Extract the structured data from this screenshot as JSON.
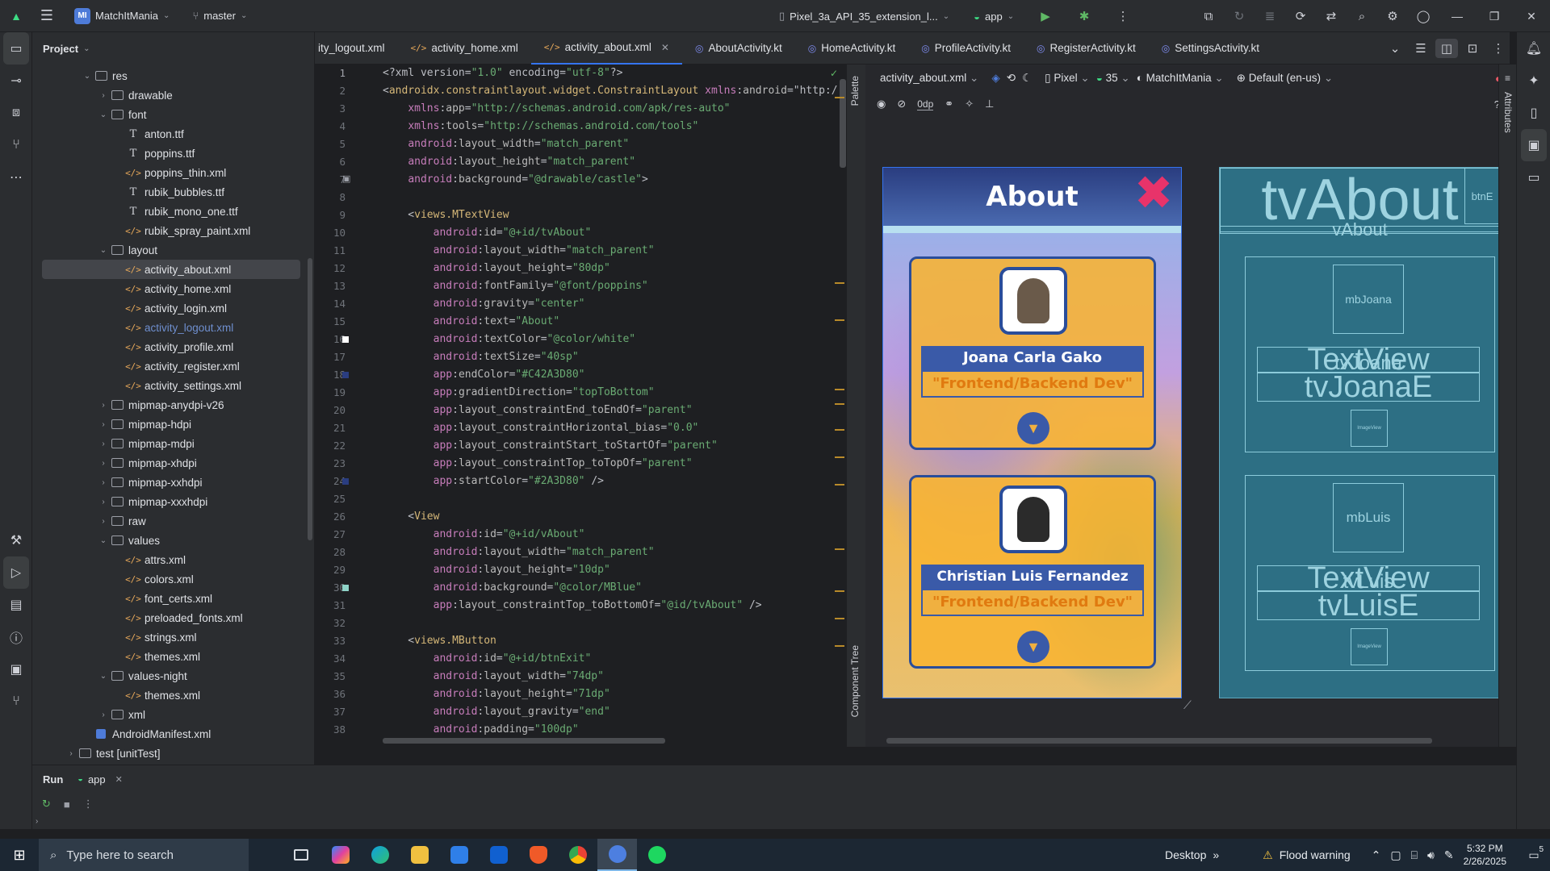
{
  "titlebar": {
    "project_initials": "MI",
    "project_name": "MatchItMania",
    "branch": "master",
    "device": "Pixel_3a_API_35_extension_l...",
    "run_config": "app"
  },
  "project_panel": {
    "title": "Project",
    "tree": [
      {
        "label": "res",
        "type": "folder",
        "depth": 3,
        "open": true
      },
      {
        "label": "drawable",
        "type": "folder",
        "depth": 4,
        "open": false
      },
      {
        "label": "font",
        "type": "folder",
        "depth": 4,
        "open": true
      },
      {
        "label": "anton.ttf",
        "type": "ttf",
        "depth": 5
      },
      {
        "label": "poppins.ttf",
        "type": "ttf",
        "depth": 5
      },
      {
        "label": "poppins_thin.xml",
        "type": "xml",
        "depth": 5
      },
      {
        "label": "rubik_bubbles.ttf",
        "type": "ttf",
        "depth": 5
      },
      {
        "label": "rubik_mono_one.ttf",
        "type": "ttf",
        "depth": 5
      },
      {
        "label": "rubik_spray_paint.xml",
        "type": "xml",
        "depth": 5
      },
      {
        "label": "layout",
        "type": "folder",
        "depth": 4,
        "open": true
      },
      {
        "label": "activity_about.xml",
        "type": "xml",
        "depth": 5,
        "selected": true
      },
      {
        "label": "activity_home.xml",
        "type": "xml",
        "depth": 5
      },
      {
        "label": "activity_login.xml",
        "type": "xml",
        "depth": 5
      },
      {
        "label": "activity_logout.xml",
        "type": "xml",
        "depth": 5,
        "dim": true
      },
      {
        "label": "activity_profile.xml",
        "type": "xml",
        "depth": 5
      },
      {
        "label": "activity_register.xml",
        "type": "xml",
        "depth": 5
      },
      {
        "label": "activity_settings.xml",
        "type": "xml",
        "depth": 5
      },
      {
        "label": "mipmap-anydpi-v26",
        "type": "folder",
        "depth": 4,
        "open": false
      },
      {
        "label": "mipmap-hdpi",
        "type": "folder",
        "depth": 4,
        "open": false
      },
      {
        "label": "mipmap-mdpi",
        "type": "folder",
        "depth": 4,
        "open": false
      },
      {
        "label": "mipmap-xhdpi",
        "type": "folder",
        "depth": 4,
        "open": false
      },
      {
        "label": "mipmap-xxhdpi",
        "type": "folder",
        "depth": 4,
        "open": false
      },
      {
        "label": "mipmap-xxxhdpi",
        "type": "folder",
        "depth": 4,
        "open": false
      },
      {
        "label": "raw",
        "type": "folder",
        "depth": 4,
        "open": false
      },
      {
        "label": "values",
        "type": "folder",
        "depth": 4,
        "open": true
      },
      {
        "label": "attrs.xml",
        "type": "xml",
        "depth": 5
      },
      {
        "label": "colors.xml",
        "type": "xml",
        "depth": 5
      },
      {
        "label": "font_certs.xml",
        "type": "xml",
        "depth": 5
      },
      {
        "label": "preloaded_fonts.xml",
        "type": "xml",
        "depth": 5
      },
      {
        "label": "strings.xml",
        "type": "xml",
        "depth": 5
      },
      {
        "label": "themes.xml",
        "type": "xml",
        "depth": 5
      },
      {
        "label": "values-night",
        "type": "folder",
        "depth": 4,
        "open": true
      },
      {
        "label": "themes.xml",
        "type": "xml",
        "depth": 5
      },
      {
        "label": "xml",
        "type": "folder",
        "depth": 4,
        "open": false
      },
      {
        "label": "AndroidManifest.xml",
        "type": "manifest",
        "depth": 3
      },
      {
        "label": "test [unitTest]",
        "type": "folder",
        "depth": 2,
        "open": false
      }
    ]
  },
  "tabs": [
    {
      "label": "ity_logout.xml",
      "kind": "xml"
    },
    {
      "label": "activity_home.xml",
      "kind": "xml"
    },
    {
      "label": "activity_about.xml",
      "kind": "xml",
      "active": true
    },
    {
      "label": "AboutActivity.kt",
      "kind": "kt"
    },
    {
      "label": "HomeActivity.kt",
      "kind": "kt"
    },
    {
      "label": "ProfileActivity.kt",
      "kind": "kt"
    },
    {
      "label": "RegisterActivity.kt",
      "kind": "kt"
    },
    {
      "label": "SettingsActivity.kt",
      "kind": "kt"
    }
  ],
  "code_lines": [
    "<?xml version=\"1.0\" encoding=\"utf-8\"?>",
    "<androidx.constraintlayout.widget.ConstraintLayout xmlns:android=\"http:/",
    "    xmlns:app=\"http://schemas.android.com/apk/res-auto\"",
    "    xmlns:tools=\"http://schemas.android.com/tools\"",
    "    android:layout_width=\"match_parent\"",
    "    android:layout_height=\"match_parent\"",
    "    android:background=\"@drawable/castle\">",
    "",
    "    <views.MTextView",
    "        android:id=\"@+id/tvAbout\"",
    "        android:layout_width=\"match_parent\"",
    "        android:layout_height=\"80dp\"",
    "        android:fontFamily=\"@font/poppins\"",
    "        android:gravity=\"center\"",
    "        android:text=\"About\"",
    "        android:textColor=\"@color/white\"",
    "        android:textSize=\"40sp\"",
    "        app:endColor=\"#C42A3D80\"",
    "        app:gradientDirection=\"topToBottom\"",
    "        app:layout_constraintEnd_toEndOf=\"parent\"",
    "        app:layout_constraintHorizontal_bias=\"0.0\"",
    "        app:layout_constraintStart_toStartOf=\"parent\"",
    "        app:layout_constraintTop_toTopOf=\"parent\"",
    "        app:startColor=\"#2A3D80\" />",
    "",
    "    <View",
    "        android:id=\"@+id/vAbout\"",
    "        android:layout_width=\"match_parent\"",
    "        android:layout_height=\"10dp\"",
    "        android:background=\"@color/MBlue\"",
    "        app:layout_constraintTop_toBottomOf=\"@id/tvAbout\" />",
    "",
    "    <views.MButton",
    "        android:id=\"@+id/btnExit\"",
    "        android:layout_width=\"74dp\"",
    "        android:layout_height=\"71dp\"",
    "        android:layout_gravity=\"end\"",
    "        android:padding=\"100dp\""
  ],
  "gutter_colors": {
    "16": "#ffffff",
    "18": "#2a3d80",
    "24": "#2a3d80",
    "30": "#8fd3c8"
  },
  "design_toolbar": {
    "file": "activity_about.xml",
    "device": "Pixel",
    "api": "35",
    "theme": "MatchItMania",
    "locale": "Default (en-us)",
    "margin": "0dp"
  },
  "side_labels": {
    "palette": "Palette",
    "component_tree": "Component Tree",
    "attributes": "Attributes"
  },
  "preview": {
    "title": "About",
    "members": [
      {
        "name": "Joana Carla Gako",
        "role": "\"Frontend/Backend Dev\""
      },
      {
        "name": "Christian Luis Fernandez",
        "role": "\"Frontend/Backend Dev\""
      }
    ]
  },
  "blueprint": {
    "tvAbout": "tvAbout",
    "vAbout": "vAbout",
    "btnExit": "btnE",
    "card1": {
      "mb": "mbJoana",
      "textview": "TextView",
      "tv": "tvJoana",
      "tvE": "tvJoanaE",
      "img": "ImageView"
    },
    "card2": {
      "mb": "mbLuis",
      "textview": "TextView",
      "tv": "tvLuis",
      "tvE": "tvLuisE",
      "img": "ImageView"
    }
  },
  "run_panel": {
    "run_label": "Run",
    "app_tab": "app"
  },
  "taskbar": {
    "search_placeholder": "Type here to search",
    "desktop": "Desktop",
    "weather": "Flood warning",
    "time": "5:32 PM",
    "date": "2/26/2025",
    "notifications": "5"
  }
}
